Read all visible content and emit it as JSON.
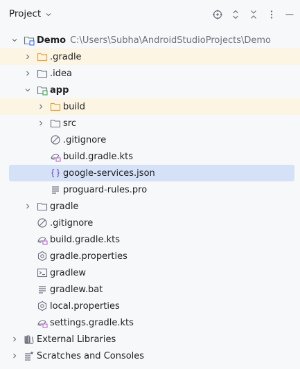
{
  "panel": {
    "title": "Project",
    "toolbar": [
      "locate-icon",
      "expand-all-icon",
      "collapse-all-icon",
      "more-icon",
      "hide-icon"
    ]
  },
  "tree": {
    "root_label": "Demo",
    "root_path": "C:\\Users\\Subha\\AndroidStudioProjects\\Demo",
    "gradle_dir": ".gradle",
    "idea_dir": ".idea",
    "app_module": "app",
    "app_build": "build",
    "app_src": "src",
    "app_gitignore": ".gitignore",
    "app_build_gradle": "build.gradle.kts",
    "app_google_services": "google-services.json",
    "app_proguard": "proguard-rules.pro",
    "gradle_folder": "gradle",
    "root_gitignore": ".gitignore",
    "root_build_gradle": "build.gradle.kts",
    "gradle_properties": "gradle.properties",
    "gradlew": "gradlew",
    "gradlew_bat": "gradlew.bat",
    "local_properties": "local.properties",
    "settings_gradle": "settings.gradle.kts",
    "external_libraries": "External Libraries",
    "scratches": "Scratches and Consoles"
  },
  "colors": {
    "highlight_bg": "#fdf5e3",
    "selected_bg": "#d5e1f7",
    "folder_orange": "#e3a23c",
    "icon_gray": "#6c707e",
    "json_purple": "#7a5ac8"
  }
}
